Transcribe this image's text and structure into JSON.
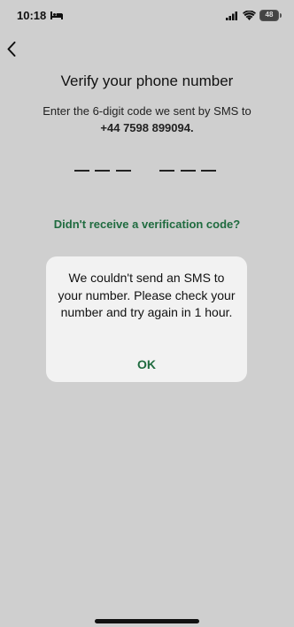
{
  "status_bar": {
    "time": "10:18",
    "battery": "48"
  },
  "header": {
    "title": "Verify your phone number",
    "subtitle": "Enter the 6-digit code we sent by SMS to",
    "phone_number": "+44 7598 899094."
  },
  "code_input": {
    "length": 6
  },
  "resend_link": "Didn't receive a verification code?",
  "dialog": {
    "message": "We couldn't send an SMS to your number. Please check your number and try again in 1 hour.",
    "ok_label": "OK"
  },
  "colors": {
    "accent": "#1f6b3f",
    "background": "#cfcfcf",
    "dialog_background": "#f2f2f2"
  },
  "icons": [
    "bed-icon",
    "signal-icon",
    "wifi-icon",
    "battery-icon",
    "back-chevron-icon"
  ]
}
